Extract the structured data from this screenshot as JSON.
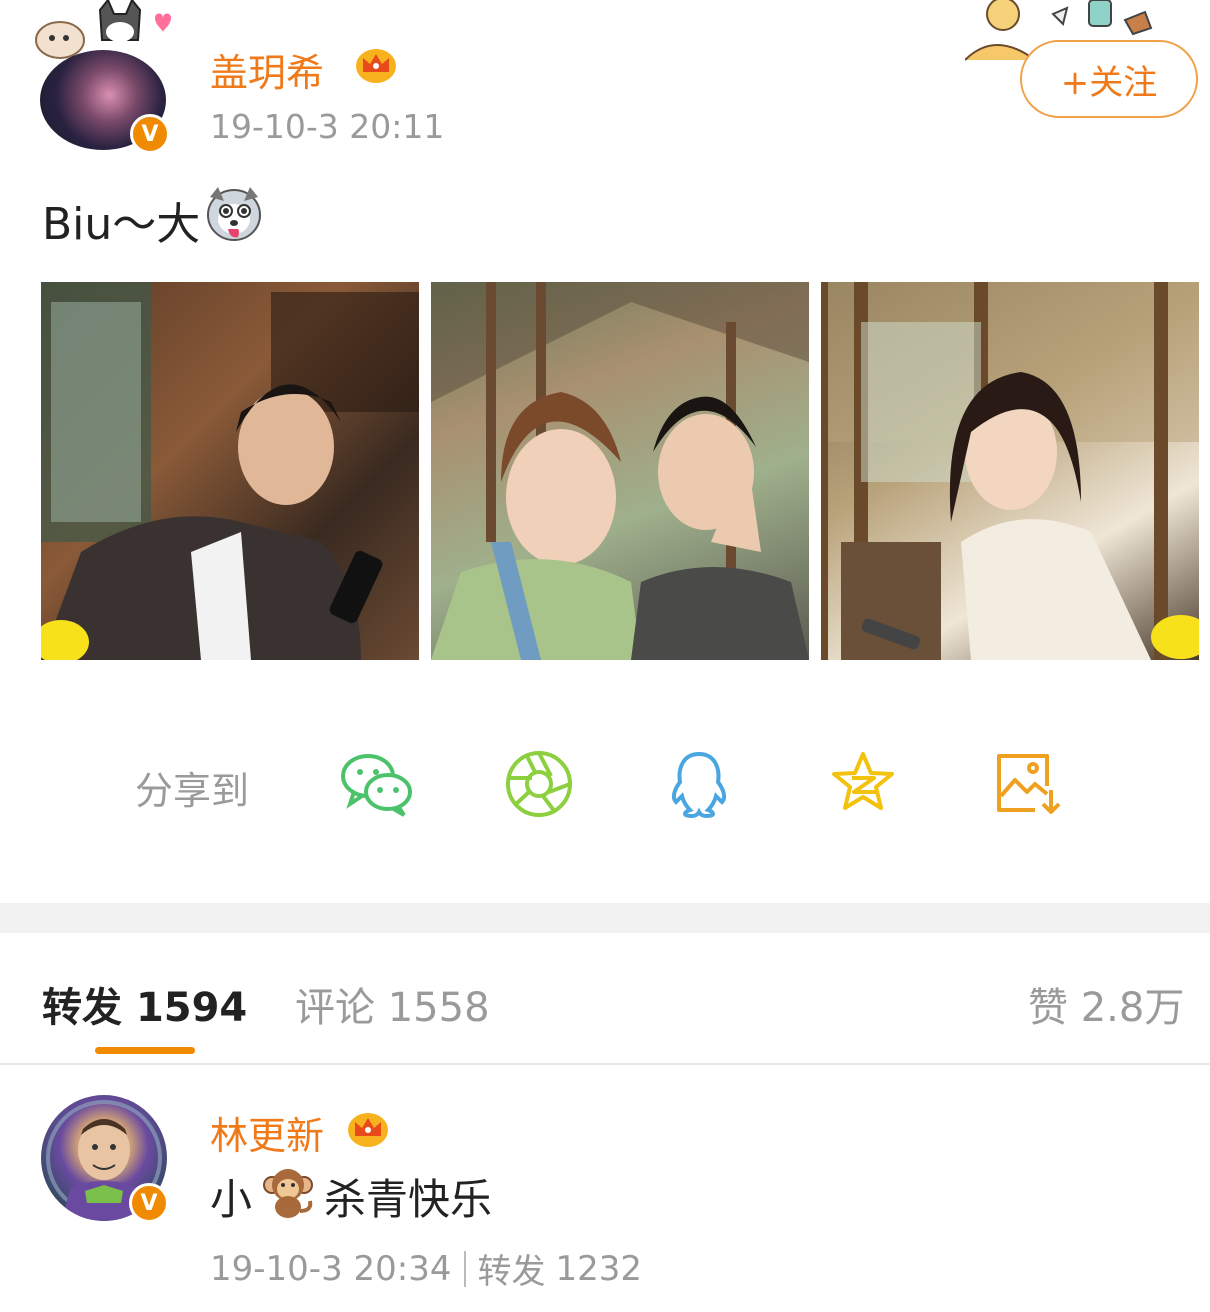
{
  "post": {
    "author": "盖玥希",
    "timestamp": "19-10-3 20:11",
    "follow_label": "+关注",
    "text": "Biu～大"
  },
  "share": {
    "label": "分享到",
    "targets": [
      "wechat-icon",
      "moments-icon",
      "qq-icon",
      "qzone-icon",
      "save-image-icon"
    ]
  },
  "tabs": {
    "repost": {
      "label": "转发",
      "count": "1594"
    },
    "comment": {
      "label": "评论",
      "count": "1558"
    },
    "like": {
      "label": "赞",
      "count": "2.8万"
    }
  },
  "reposts": [
    {
      "author": "林更新",
      "text_before": "小",
      "text_after": " 杀青快乐",
      "timestamp": "19-10-3 20:34",
      "repost_label": "转发",
      "repost_count": "1232"
    }
  ],
  "colors": {
    "accent": "#f07a1a",
    "wechat": "#4cc36b",
    "moments": "#8ccf3f",
    "qq": "#4aa6e0",
    "qzone": "#f2c20e",
    "save": "#f0a020"
  }
}
